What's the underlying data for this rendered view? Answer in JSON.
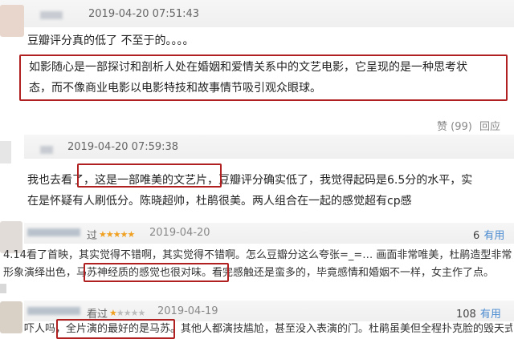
{
  "c1": {
    "date": "2019-04-20 07:51:43",
    "line1": "豆瓣评分真的低了 不至于的。。。。",
    "quote_l1": "如影随心是一部探讨和剖析人处在婚姻和爱情关系中的文艺电影，它呈现的是一种思考状",
    "quote_l2": "态，而不像商业电影以电影特技和故事情节吸引观众眼球。",
    "like": "赞 (99)",
    "reply": "回应"
  },
  "c2": {
    "date": "2019-04-20 07:59:38",
    "l1_a": "我也去看了",
    "l1_box": "，这是一部唯美的文艺片",
    "l1_b": "，豆瓣评分确实低了，我觉得起码是6.5分的水平，实",
    "l2": "在是怀疑有人刷低分。陈晓超帅，杜鹃很美。两人组合在一起的感觉超有cp感"
  },
  "r1": {
    "user_suffix": "过",
    "stars_on": "★★★★★",
    "stars_off": "",
    "date": "2019-04-20",
    "useful_count": "6",
    "useful_label": "有用",
    "l1": "4.14看了首映，其实觉得不错啊，其实觉得不错啊。怎么豆瓣分这么夸张=_=… 画面非常唯美，杜鹃造型非常好看，陈晓渣男",
    "l2_a": "形象演绎出色",
    "l2_box": "，马苏神经质的感觉也很对味。",
    "l2_b": "看完感触还是蛮多的，毕竟感情和婚姻不一样，女主作了点。"
  },
  "r2": {
    "user_suffix": "看过",
    "stars_on": "★",
    "stars_off": "★★★★",
    "date": "2019-04-19",
    "useful_count": "108",
    "useful_label": "有用",
    "l1_a": "吓人吗",
    "l1_box": "，全片演的最好的是马苏。",
    "l1_b": "其他人都演技尴尬，甚至没入表演的门。杜鹃虽美但全程扑克脸的毁天式"
  },
  "colors": {
    "highlight_border": "#b02020",
    "star": "#f0a020",
    "link": "#4a8bd0"
  }
}
